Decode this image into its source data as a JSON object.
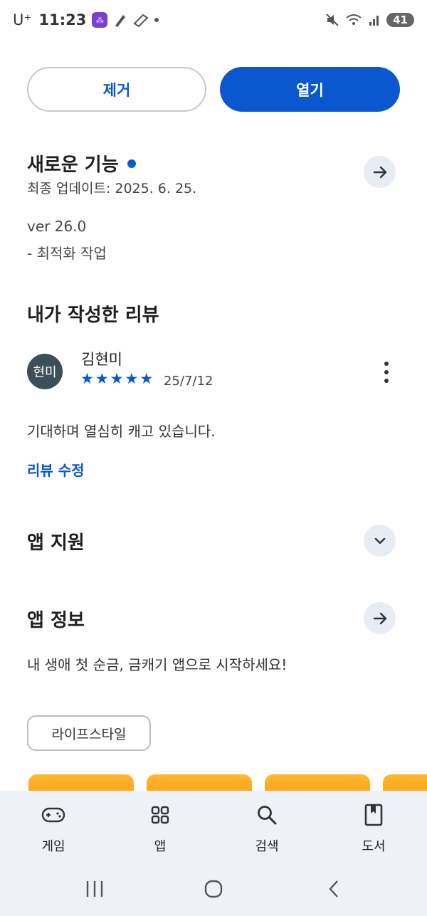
{
  "status_bar": {
    "carrier": "U⁺",
    "time": "11:23",
    "battery": "41"
  },
  "actions": {
    "remove_label": "제거",
    "open_label": "열기"
  },
  "whats_new": {
    "title": "새로운 기능",
    "updated": "최종 업데이트: 2025. 6. 25.",
    "version": "ver 26.0",
    "note": "- 최적화 작업"
  },
  "my_review": {
    "title": "내가 작성한 리뷰",
    "avatar_text": "현미",
    "reviewer": "김현미",
    "rating": 5,
    "date": "25/7/12",
    "text": "기대하며 열심히 캐고 있습니다.",
    "edit_link": "리뷰 수정"
  },
  "app_support": {
    "title": "앱 지원"
  },
  "app_info": {
    "title": "앱 정보",
    "description": "내 생애 첫 순금, 금캐기 앱으로 시작하세요!",
    "category_chip": "라이프스타일"
  },
  "bottom_nav": {
    "items": [
      {
        "label": "게임",
        "icon": "gamepad-icon"
      },
      {
        "label": "앱",
        "icon": "apps-grid-icon"
      },
      {
        "label": "검색",
        "icon": "search-icon"
      },
      {
        "label": "도서",
        "icon": "book-icon"
      }
    ]
  },
  "colors": {
    "accent": "#0b57d0",
    "nav_background": "#eef1f8",
    "circle_button": "#e8ecf5",
    "avatar": "#3c4f58"
  }
}
